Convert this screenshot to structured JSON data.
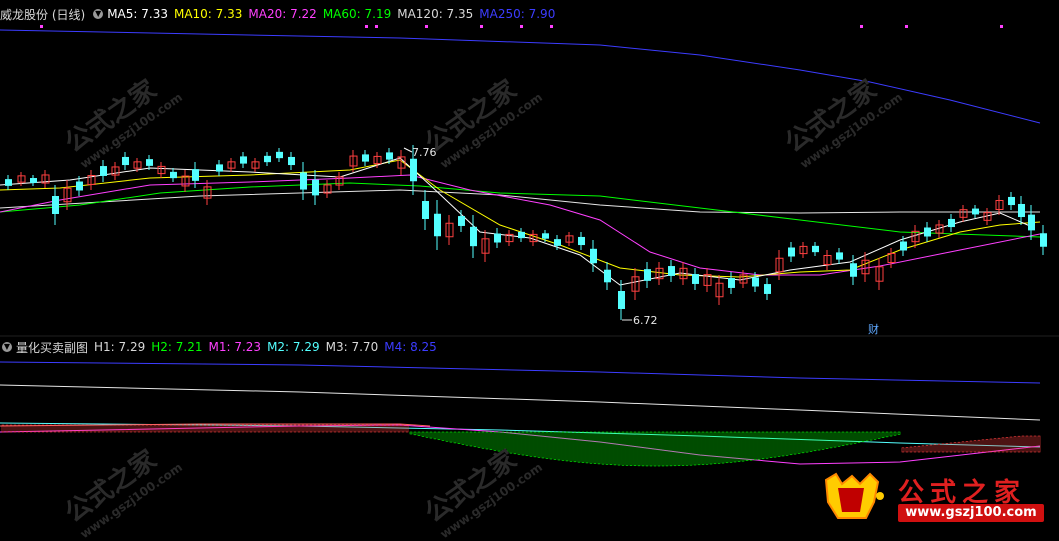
{
  "main_header": {
    "stock_name": "威龙股份 (日线)",
    "ma5": "MA5: 7.33",
    "ma10": "MA10: 7.33",
    "ma20": "MA20: 7.22",
    "ma60": "MA60: 7.19",
    "ma120": "MA120: 7.35",
    "ma250": "MA250: 7.90"
  },
  "sub_header": {
    "title": "量化买卖副图",
    "h1": "H1: 7.29",
    "h2": "H2: 7.21",
    "m1": "M1: 7.23",
    "m2": "M2: 7.29",
    "m3": "M3: 7.70",
    "m4": "M4: 8.25"
  },
  "annotations": {
    "high_label": "7.76",
    "low_label": "6.72",
    "fin_marker": "财"
  },
  "watermark": {
    "text": "公式之家",
    "url": "www.gszj100.com"
  },
  "logo": {
    "brand": "公式之家",
    "url": "www.gszj100.com"
  },
  "colors": {
    "up": "#ff4040",
    "down": "#54ffff",
    "ma5": "#ffffff",
    "ma10": "#ffff00",
    "ma20": "#ff40ff",
    "ma60": "#00ff00",
    "ma120": "#ffffff",
    "ma250": "#3c3cff",
    "h1": "#ffffff",
    "h2": "#00ff00",
    "m1": "#ff40ff",
    "m2": "#54ffff",
    "m3": "#ffffff",
    "m4": "#3c3cff"
  }
}
